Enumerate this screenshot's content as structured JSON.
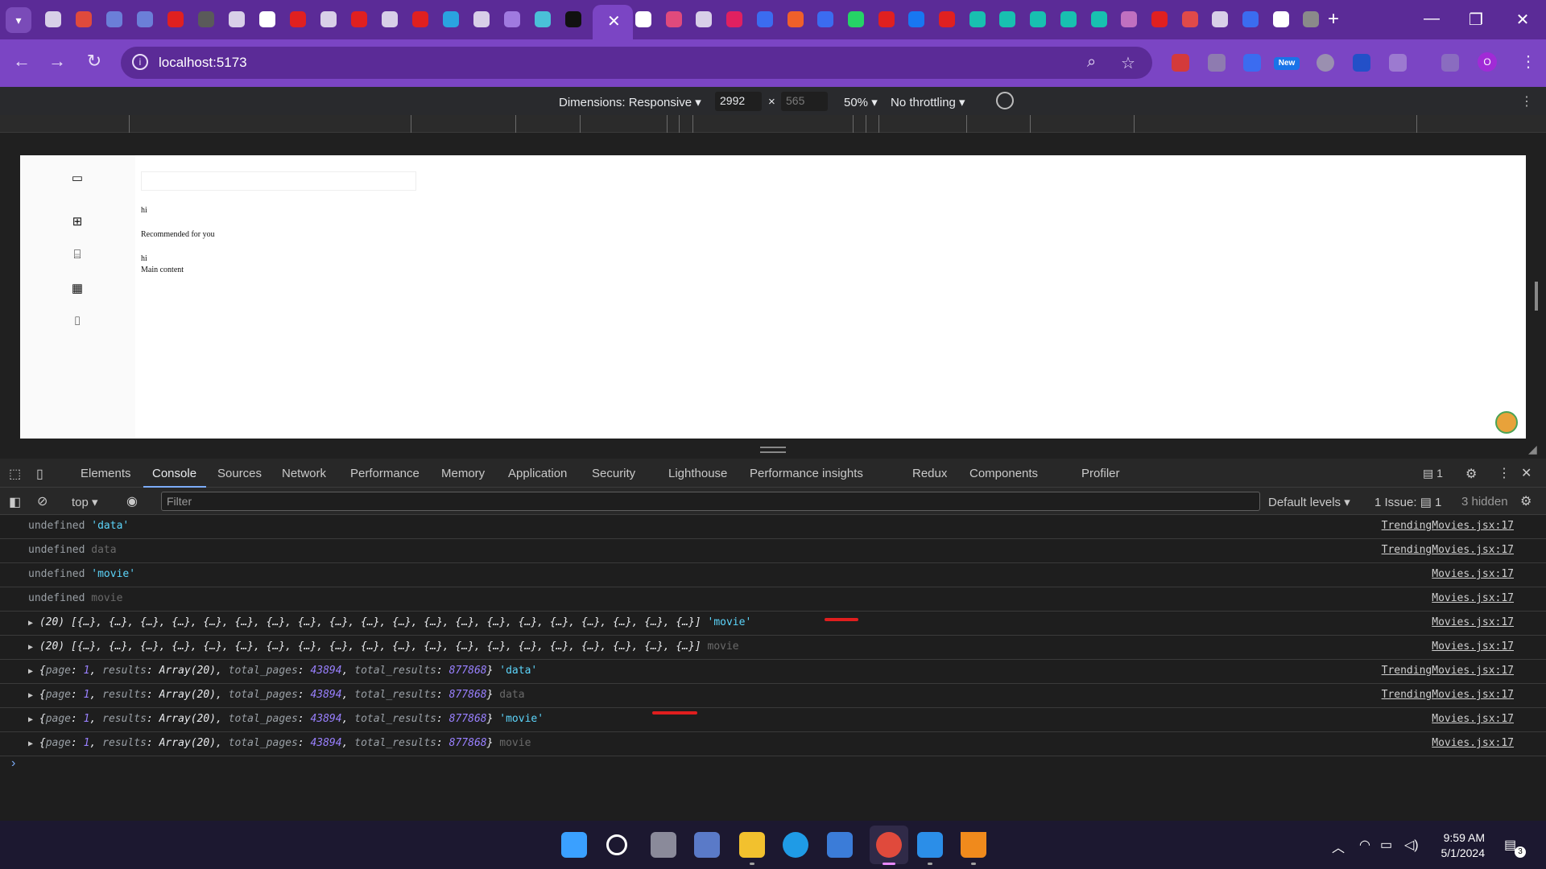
{
  "browser": {
    "url": "localhost:5173",
    "tab_count_visible": 42,
    "new_badge": "New",
    "profile_initial": "O"
  },
  "device_toolbar": {
    "dimensions_label": "Dimensions: Responsive",
    "width": "2992",
    "height": "565",
    "zoom": "50%",
    "throttling": "No throttling"
  },
  "viewport_page": {
    "line1": "hi",
    "recommended": "Recommended for you",
    "line2": "hi",
    "main": "Main content",
    "sidebar_icons": [
      "clapperboard-icon",
      "grid-icon",
      "tv-icon",
      "film-icon",
      "bookmark-icon"
    ]
  },
  "devtools": {
    "tabs": [
      "Elements",
      "Console",
      "Sources",
      "Network",
      "Performance",
      "Memory",
      "Application",
      "Security",
      "Lighthouse",
      "Performance insights",
      "Redux",
      "Components",
      "Profiler"
    ],
    "active_tab": "Console",
    "issues_badge": "1",
    "context": "top",
    "filter_placeholder": "Filter",
    "levels": "Default levels",
    "issues_label": "1 Issue:",
    "issues_count": "1",
    "hidden": "3 hidden"
  },
  "console": {
    "rows": [
      {
        "a": "undefined",
        "b": "'data'",
        "src": "TrendingMovies.jsx:17"
      },
      {
        "a": "undefined",
        "b": "data",
        "src": "TrendingMovies.jsx:17"
      },
      {
        "a": "undefined",
        "b": "'movie'",
        "src": "Movies.jsx:17"
      },
      {
        "a": "undefined",
        "b": "movie",
        "src": "Movies.jsx:17"
      },
      {
        "a": "(20) [{…}, {…}, {…}, {…}, {…}, {…}, {…}, {…}, {…}, {…}, {…}, {…}, {…}, {…}, {…}, {…}, {…}, {…}, {…}, {…}]",
        "b": "'movie'",
        "src": "Movies.jsx:17"
      },
      {
        "a": "(20) [{…}, {…}, {…}, {…}, {…}, {…}, {…}, {…}, {…}, {…}, {…}, {…}, {…}, {…}, {…}, {…}, {…}, {…}, {…}, {…}]",
        "b": "movie",
        "src": "Movies.jsx:17"
      },
      {
        "page": "1",
        "total_pages": "43894",
        "total_results": "877868",
        "b": "'data'",
        "src": "TrendingMovies.jsx:17"
      },
      {
        "page": "1",
        "total_pages": "43894",
        "total_results": "877868",
        "b": "data",
        "src": "TrendingMovies.jsx:17"
      },
      {
        "page": "1",
        "total_pages": "43894",
        "total_results": "877868",
        "b": "'movie'",
        "src": "Movies.jsx:17"
      },
      {
        "page": "1",
        "total_pages": "43894",
        "total_results": "877868",
        "b": "movie",
        "src": "Movies.jsx:17"
      }
    ],
    "obj": {
      "page_key": "page",
      "results_key": "results",
      "results_val": "Array(20)",
      "tp_key": "total_pages",
      "tr_key": "total_results"
    }
  },
  "taskbar": {
    "time": "9:59 AM",
    "date": "5/1/2024",
    "notifications": "3"
  },
  "colors": {
    "tabstrip": "#5b2b97",
    "toolbar": "#7b45c4",
    "accent": "#7cacf8",
    "string": "#5cd5fb",
    "number": "#9980ff"
  }
}
